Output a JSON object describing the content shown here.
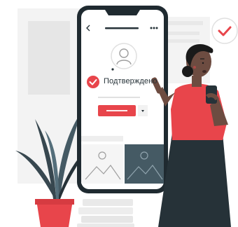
{
  "profile_card": {
    "verified_label": "Подтверждено"
  },
  "colors": {
    "accent": "#E8454B",
    "dark": "#263238",
    "phone_frame": "#1F2A30",
    "background_shapes": "#F2F2F2",
    "image_tile_dark": "#455A64"
  },
  "icons": [
    "back-arrow-icon",
    "more-dots-icon",
    "avatar-icon",
    "checkmark-icon",
    "dropdown-chevron-icon",
    "landscape-image-icon",
    "checkmark-bubble-icon"
  ]
}
